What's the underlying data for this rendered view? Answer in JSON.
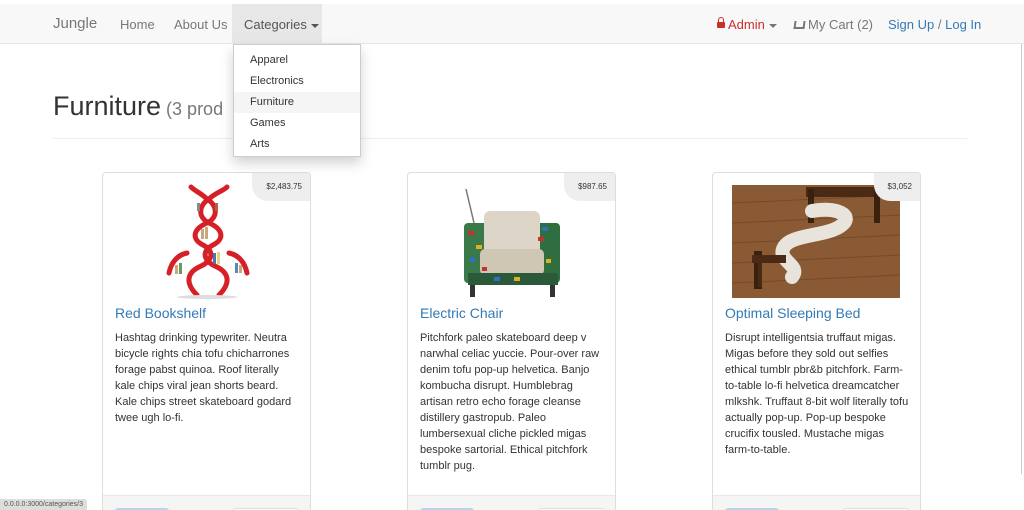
{
  "navbar": {
    "brand": "Jungle",
    "home": "Home",
    "about": "About Us",
    "categories": "Categories",
    "admin": "Admin",
    "cart": "My Cart (2)",
    "signup": "Sign Up",
    "slash": "/",
    "login": "Log In"
  },
  "dropdown": {
    "items": [
      "Apparel",
      "Electronics",
      "Furniture",
      "Games",
      "Arts"
    ],
    "active_index": 2
  },
  "page": {
    "title": "Furniture",
    "count": "(3 prod"
  },
  "products": [
    {
      "name": "Red Bookshelf",
      "price": "$2,483.75",
      "description": "Hashtag drinking typewriter. Neutra bicycle rights chia tofu chicharrones forage pabst quinoa. Roof literally kale chips viral jean shorts beard. Kale chips street skateboard godard twee ugh lo-fi."
    },
    {
      "name": "Electric Chair",
      "price": "$987.65",
      "description": "Pitchfork paleo skateboard deep v narwhal celiac yuccie. Pour-over raw denim tofu pop-up helvetica. Banjo kombucha disrupt. Humblebrag artisan retro echo forage cleanse distillery gastropub. Paleo lumbersexual cliche pickled migas bespoke sartorial. Ethical pitchfork tumblr pug."
    },
    {
      "name": "Optimal Sleeping Bed",
      "price": "$3,052",
      "description": "Disrupt intelligentsia truffaut migas. Migas before they sold out selfies ethical tumblr pbr&b pitchfork. Farm-to-table lo-fi helvetica dreamcatcher mlkshk. Truffaut 8-bit wolf literally tofu actually pop-up. Pop-up bespoke crucifix tousled. Mustache migas farm-to-table."
    }
  ],
  "status_url": "0.0.0.0:3000/categories/3",
  "colors": {
    "link": "#337ab7",
    "admin": "#c9302c",
    "navbar_bg": "#f8f8f8"
  }
}
